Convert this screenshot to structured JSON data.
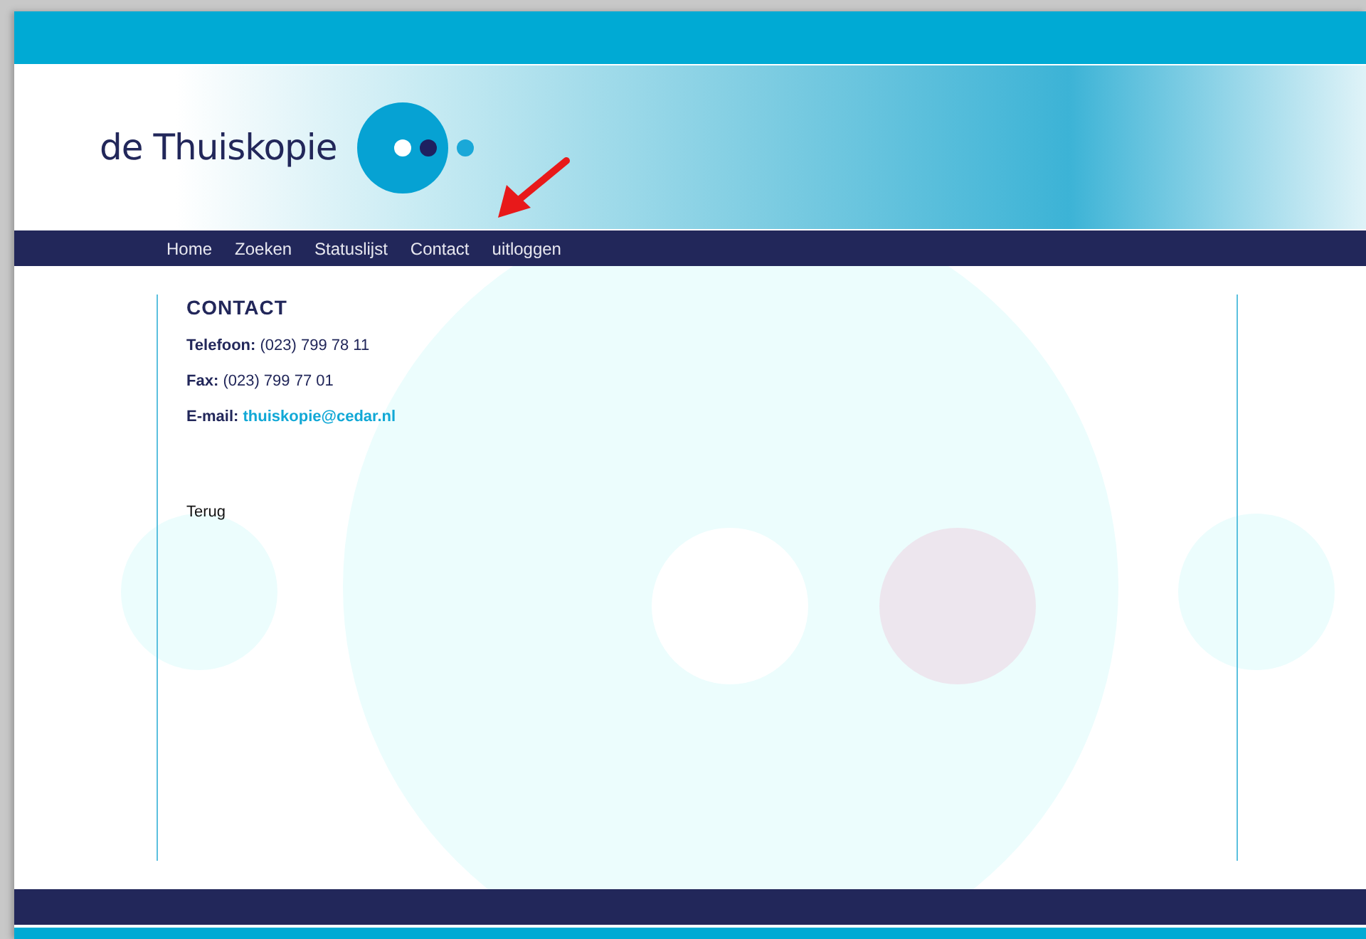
{
  "header": {
    "logo_text": "de Thuiskopie"
  },
  "nav": {
    "items": [
      "Home",
      "Zoeken",
      "Statuslijst",
      "Contact",
      "uitloggen"
    ]
  },
  "content": {
    "heading": "CONTACT",
    "details": [
      {
        "kind": "text",
        "label": "Telefoon:",
        "value": "(023) 799 78 11"
      },
      {
        "kind": "text",
        "label": "Fax:",
        "value": "(023) 799 77 01"
      },
      {
        "kind": "link",
        "label": "E-mail:",
        "value": "thuiskopie@cedar.nl"
      }
    ],
    "back_link": "Terug"
  }
}
